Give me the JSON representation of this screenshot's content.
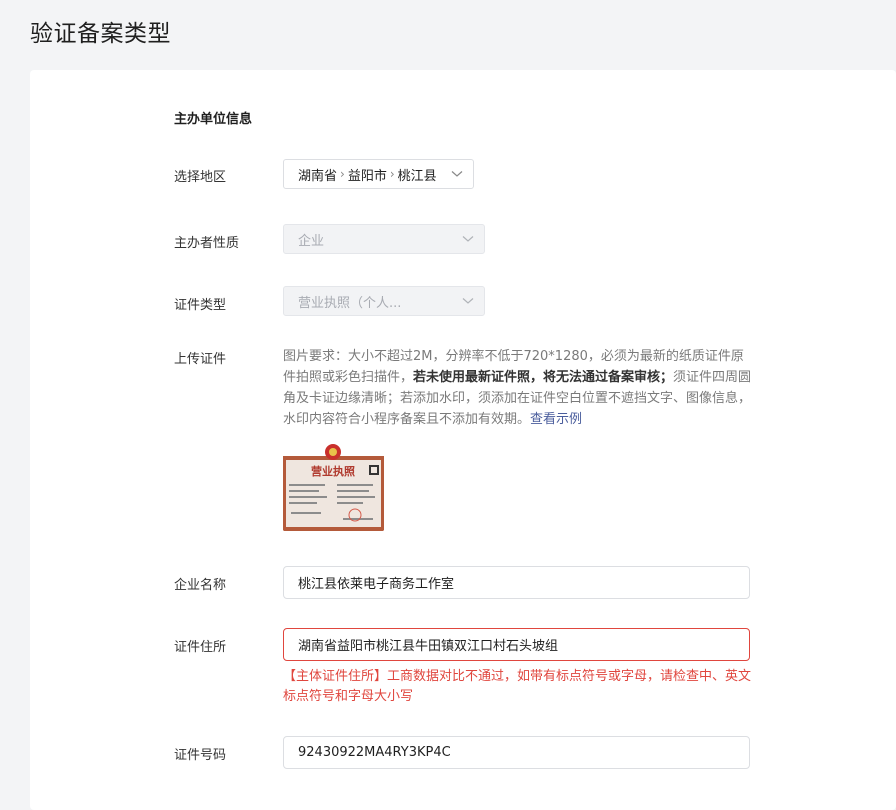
{
  "page": {
    "title": "验证备案类型"
  },
  "form": {
    "section_title": "主办单位信息",
    "region": {
      "label": "选择地区",
      "province": "湖南省",
      "city": "益阳市",
      "county": "桃江县",
      "separator": "›"
    },
    "organizer_type": {
      "label": "主办者性质",
      "value": "企业"
    },
    "cert_type": {
      "label": "证件类型",
      "value": "营业执照（个人..."
    },
    "upload": {
      "label": "上传证件",
      "desc_part1": "图片要求：大小不超过2M，分辨率不低于720*1280，必须为最新的纸质证件原件拍照或彩色扫描件，",
      "desc_bold": "若未使用最新证件照，将无法通过备案审核；",
      "desc_part2": "须证件四周圆角及卡证边缘清晰；若添加水印，须添加在证件空白位置不遮挡文字、图像信息，水印内容符合小程序备案且不添加有效期。",
      "example_link": "查看示例",
      "thumb_text": "营业执照"
    },
    "company_name": {
      "label": "企业名称",
      "value": "桃江县依莱电子商务工作室"
    },
    "cert_address": {
      "label": "证件住所",
      "value": "湖南省益阳市桃江县牛田镇双江口村石头坡组",
      "error": "【主体证件住所】工商数据对比不通过，如带有标点符号或字母，请检查中、英文标点符号和字母大小写"
    },
    "cert_number": {
      "label": "证件号码",
      "value": "92430922MA4RY3KP4C"
    }
  },
  "colors": {
    "error": "#e0463e",
    "link": "#4a5d9c",
    "background": "#f3f4f6"
  }
}
